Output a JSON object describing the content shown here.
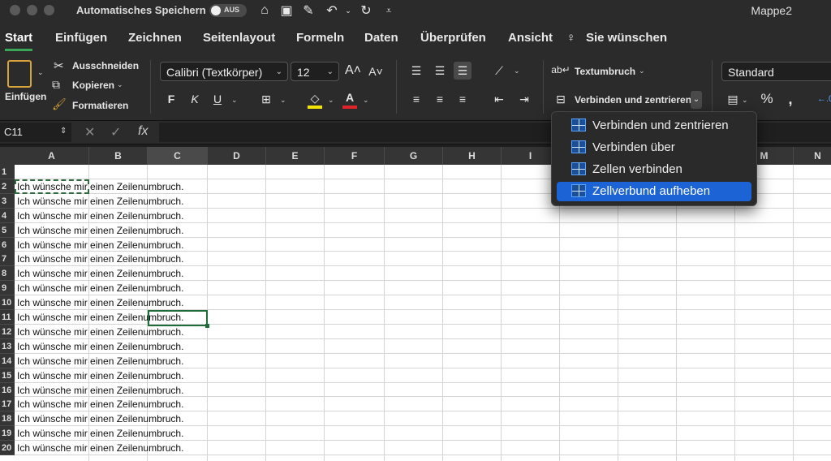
{
  "titlebar": {
    "autosave_label": "Automatisches Speichern",
    "toggle_label": "AUS",
    "document_title": "Mappe2"
  },
  "tabs": [
    {
      "label": "Start",
      "active": true
    },
    {
      "label": "Einfügen"
    },
    {
      "label": "Zeichnen"
    },
    {
      "label": "Seitenlayout"
    },
    {
      "label": "Formeln"
    },
    {
      "label": "Daten"
    },
    {
      "label": "Überprüfen"
    },
    {
      "label": "Ansicht"
    },
    {
      "label": "Sie wünschen"
    }
  ],
  "ribbon": {
    "paste_label": "Einfügen",
    "cut_label": "Ausschneiden",
    "copy_label": "Kopieren",
    "format_label": "Formatieren",
    "font_name": "Calibri (Textkörper)",
    "font_size": "12",
    "bold": "F",
    "italic": "K",
    "underline": "U",
    "wrap_label": "Textumbruch",
    "merge_label": "Verbinden und zentrieren",
    "number_format": "Standard"
  },
  "formula": {
    "namebox": "C11",
    "fx": "fx"
  },
  "columns": [
    "A",
    "B",
    "C",
    "D",
    "E",
    "F",
    "G",
    "H",
    "I",
    "J",
    "K",
    "L",
    "M",
    "N"
  ],
  "rows": [
    {
      "n": "1",
      "text": ""
    },
    {
      "n": "2",
      "text": "Ich wünsche mir einen Zeilenumbruch."
    },
    {
      "n": "3",
      "text": "Ich wünsche mir einen Zeilenumbruch."
    },
    {
      "n": "4",
      "text": "Ich wünsche mir einen Zeilenumbruch."
    },
    {
      "n": "5",
      "text": "Ich wünsche mir einen Zeilenumbruch."
    },
    {
      "n": "6",
      "text": "Ich wünsche mir einen Zeilenumbruch."
    },
    {
      "n": "7",
      "text": "Ich wünsche mir einen Zeilenumbruch."
    },
    {
      "n": "8",
      "text": "Ich wünsche mir einen Zeilenumbruch."
    },
    {
      "n": "9",
      "text": "Ich wünsche mir einen Zeilenumbruch."
    },
    {
      "n": "10",
      "text": "Ich wünsche mir einen Zeilenumbruch."
    },
    {
      "n": "11",
      "text": "Ich wünsche mir einen Zeilenumbruch."
    },
    {
      "n": "12",
      "text": "Ich wünsche mir einen Zeilenumbruch."
    },
    {
      "n": "13",
      "text": "Ich wünsche mir einen Zeilenumbruch."
    },
    {
      "n": "14",
      "text": "Ich wünsche mir einen Zeilenumbruch."
    },
    {
      "n": "15",
      "text": "Ich wünsche mir einen Zeilenumbruch."
    },
    {
      "n": "16",
      "text": "Ich wünsche mir einen Zeilenumbruch."
    },
    {
      "n": "17",
      "text": "Ich wünsche mir einen Zeilenumbruch."
    },
    {
      "n": "18",
      "text": "Ich wünsche mir einen Zeilenumbruch."
    },
    {
      "n": "19",
      "text": "Ich wünsche mir einen Zeilenumbruch."
    },
    {
      "n": "20",
      "text": "Ich wünsche mir einen Zeilenumbruch."
    }
  ],
  "merge_menu": [
    {
      "label": "Verbinden und zentrieren"
    },
    {
      "label": "Verbinden über"
    },
    {
      "label": "Zellen verbinden"
    },
    {
      "label": "Zellverbund aufheben",
      "active": true
    }
  ],
  "colors": {
    "accent_green": "#3aa657",
    "menu_highlight": "#1c64d6",
    "fill_yellow": "#f2e600",
    "font_red": "#e0242a"
  }
}
